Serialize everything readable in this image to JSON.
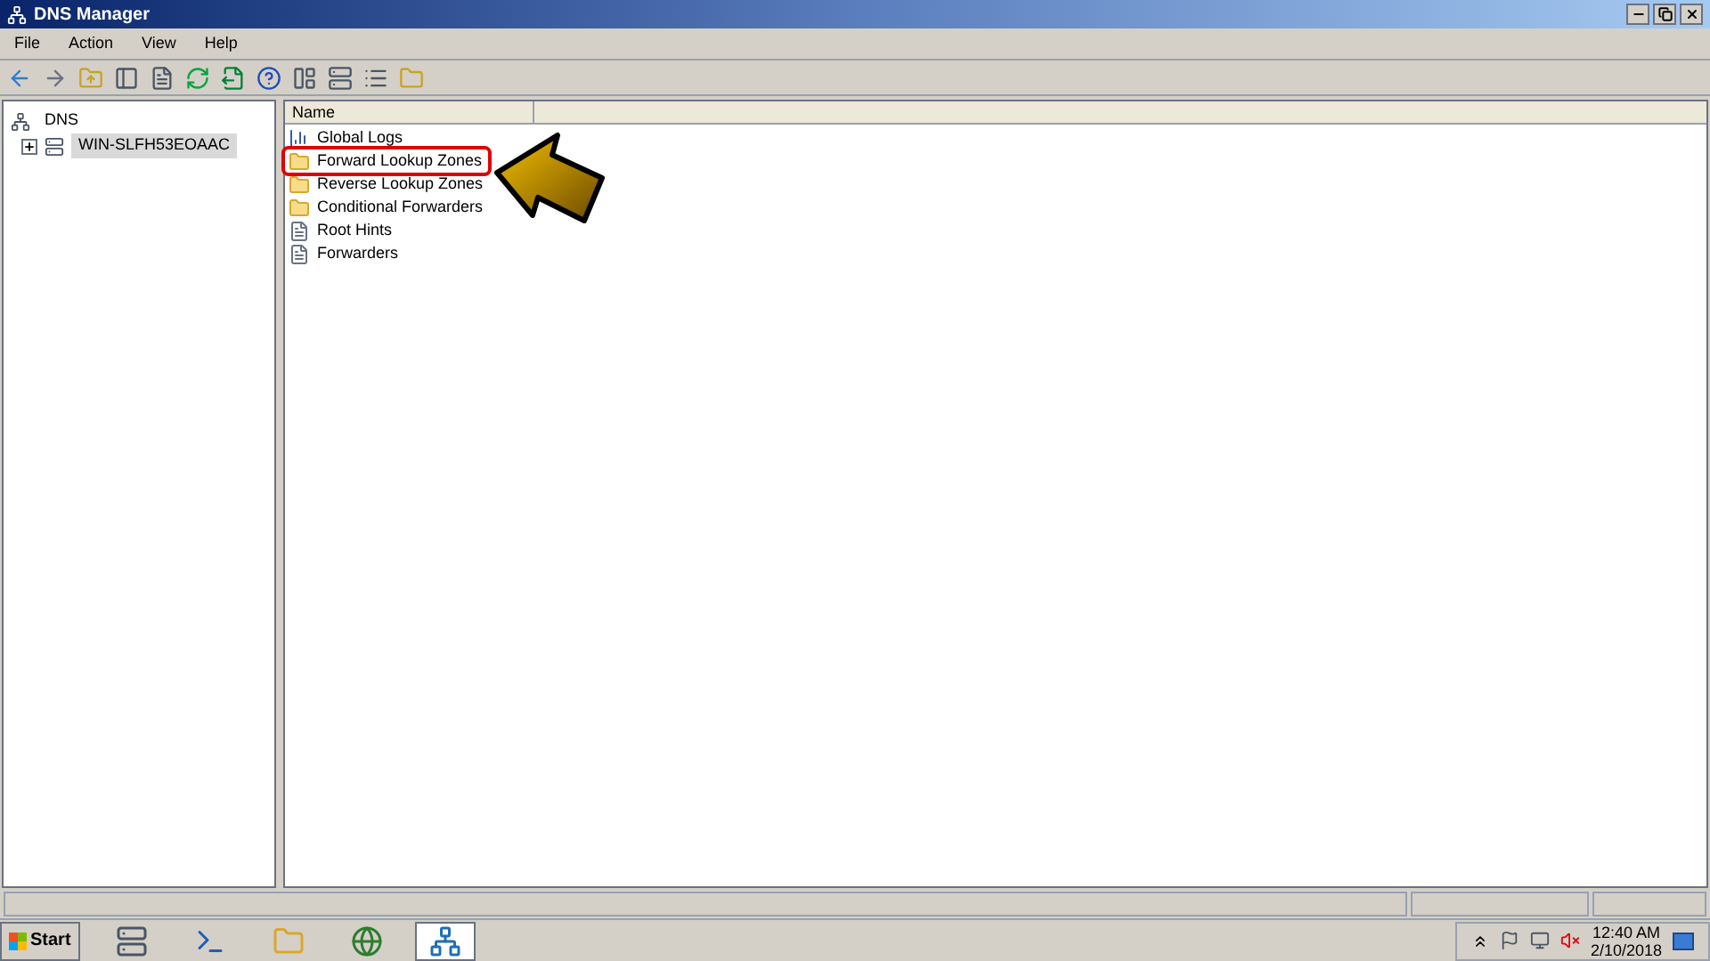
{
  "window": {
    "title": "DNS Manager"
  },
  "menu": [
    "File",
    "Action",
    "View",
    "Help"
  ],
  "tree": [
    {
      "label": "DNS",
      "selected": false,
      "children": [
        {
          "label": "WIN-SLFH53EOAAC",
          "expanded": false,
          "selected": true
        }
      ]
    }
  ],
  "list": {
    "columns": [
      "Name"
    ],
    "rows": [
      {
        "name": "Global Logs",
        "kind": "logs",
        "highlighted": false
      },
      {
        "name": "Forward Lookup Zones",
        "kind": "folder",
        "highlighted": true
      },
      {
        "name": "Reverse Lookup Zones",
        "kind": "folder",
        "highlighted": false
      },
      {
        "name": "Conditional Forwarders",
        "kind": "folder",
        "highlighted": false
      },
      {
        "name": "Root Hints",
        "kind": "file",
        "highlighted": false
      },
      {
        "name": "Forwarders",
        "kind": "file",
        "highlighted": false
      }
    ]
  },
  "taskbar": {
    "start": "Start",
    "apps": [
      {
        "kind": "server",
        "selected": false
      },
      {
        "kind": "shell",
        "selected": false
      },
      {
        "kind": "folder",
        "selected": false
      },
      {
        "kind": "globe-server",
        "selected": false
      },
      {
        "kind": "dns",
        "selected": true
      }
    ],
    "time": "12:40 AM",
    "date": "2/10/2018"
  }
}
